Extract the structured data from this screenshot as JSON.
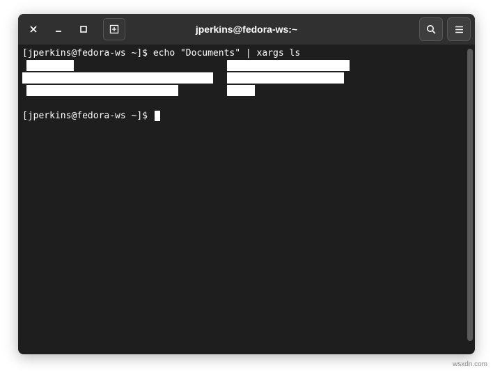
{
  "window": {
    "title": "jperkins@fedora-ws:~"
  },
  "terminal": {
    "prompt1": "[jperkins@fedora-ws ~]$ ",
    "command1": "echo \"Documents\" | xargs ls",
    "prompt2": "[jperkins@fedora-ws ~]$ "
  },
  "watermark": "wsxdn.com"
}
